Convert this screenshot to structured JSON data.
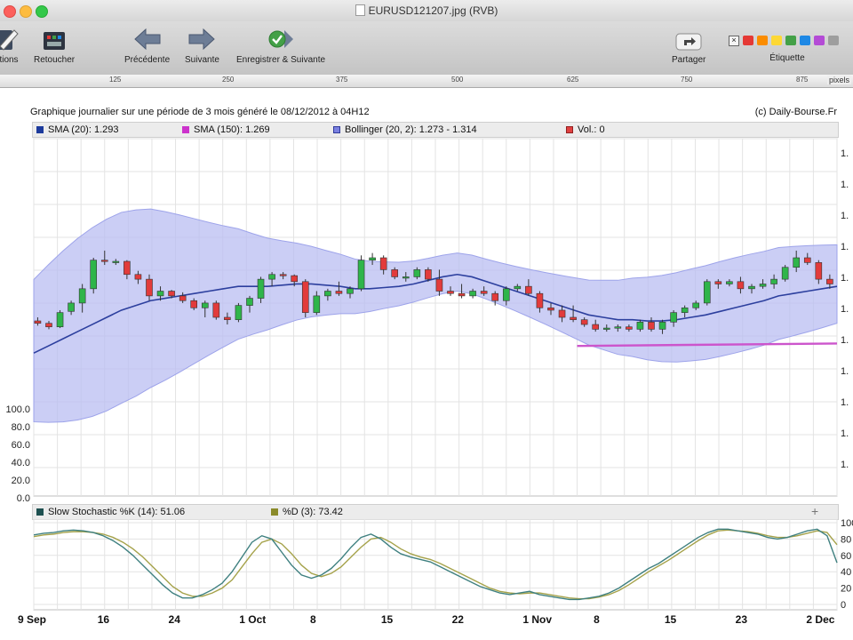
{
  "window": {
    "title": "EURUSD121207.jpg (RVB)"
  },
  "toolbar": {
    "left_items": [
      {
        "label": "tions",
        "icon": "pencil-icon"
      },
      {
        "label": "Retoucher",
        "icon": "toolbox-icon"
      },
      {
        "label": "Précédente",
        "icon": "arrow-left-icon"
      },
      {
        "label": "Suivante",
        "icon": "arrow-right-icon"
      },
      {
        "label": "Enregistrer & Suivante",
        "icon": "check-arrow-icon"
      }
    ],
    "share_label": "Partager",
    "label_label": "Étiquette",
    "label_colors": [
      "#e53935",
      "#fb8c00",
      "#fdd835",
      "#43a047",
      "#1e88e5",
      "#b44bd6",
      "#9e9e9e"
    ]
  },
  "ruler": {
    "ticks": [
      "125",
      "250",
      "375",
      "500",
      "625",
      "750",
      "875"
    ],
    "unit": "pixels"
  },
  "chart_header": {
    "caption": "Graphique journalier sur une période de 3 mois généré le 08/12/2012 à 04H12",
    "copyright": "(c) Daily-Bourse.Fr"
  },
  "legend": [
    {
      "text": "SMA (20): 1.293",
      "color": "#1c3a9c"
    },
    {
      "text": "SMA (150): 1.269",
      "color": "#cc33cc"
    },
    {
      "text": "Bollinger (20, 2): 1.273 - 1.314",
      "color": "#7a80e0"
    },
    {
      "text": "Vol.: 0",
      "color": "#e04040"
    }
  ],
  "stoch_legend": [
    {
      "text": "Slow Stochastic %K (14): 51.06",
      "color": "#1d5050"
    },
    {
      "text": "%D (3): 73.42",
      "color": "#8a8a2a"
    }
  ],
  "chart_data": {
    "type": "candlestick",
    "x_tick_labels": [
      "9 Sep",
      "16",
      "24",
      "1 Oct",
      "8",
      "15",
      "22",
      "1 Nov",
      "8",
      "15",
      "23",
      "2 Dec"
    ],
    "x_tick_index": [
      0,
      9,
      18,
      27,
      36,
      45,
      54,
      63,
      72,
      81,
      90,
      99
    ],
    "y_right_ticks": [
      "1.",
      "1.",
      "1.",
      "1.",
      "1.",
      "1.",
      "1.",
      "1.",
      "1.",
      "1.",
      "1."
    ],
    "y_left_ticks": [
      "100.0",
      "80.0",
      "60.0",
      "40.0",
      "20.0",
      "0.0"
    ],
    "ylim": [
      1.205,
      1.355
    ],
    "candles": [
      [
        1.2785,
        1.28,
        1.2765,
        1.2775
      ],
      [
        1.2775,
        1.2785,
        1.275,
        1.276
      ],
      [
        1.276,
        1.283,
        1.2755,
        1.282
      ],
      [
        1.2825,
        1.287,
        1.281,
        1.286
      ],
      [
        1.286,
        1.294,
        1.282,
        1.292
      ],
      [
        1.292,
        1.305,
        1.29,
        1.304
      ],
      [
        1.304,
        1.308,
        1.302,
        1.3035
      ],
      [
        1.3035,
        1.3045,
        1.302,
        1.3035
      ],
      [
        1.3035,
        1.304,
        1.296,
        1.298
      ],
      [
        1.298,
        1.2995,
        1.294,
        1.296
      ],
      [
        1.296,
        1.298,
        1.287,
        1.289
      ],
      [
        1.289,
        1.293,
        1.287,
        1.291
      ],
      [
        1.291,
        1.2915,
        1.288,
        1.289
      ],
      [
        1.289,
        1.2905,
        1.286,
        1.287
      ],
      [
        1.287,
        1.288,
        1.283,
        1.284
      ],
      [
        1.284,
        1.287,
        1.28,
        1.286
      ],
      [
        1.286,
        1.287,
        1.279,
        1.28
      ],
      [
        1.28,
        1.282,
        1.277,
        1.279
      ],
      [
        1.279,
        1.286,
        1.278,
        1.285
      ],
      [
        1.285,
        1.289,
        1.282,
        1.288
      ],
      [
        1.288,
        1.297,
        1.286,
        1.296
      ],
      [
        1.296,
        1.299,
        1.293,
        1.298
      ],
      [
        1.298,
        1.299,
        1.296,
        1.2975
      ],
      [
        1.2975,
        1.298,
        1.293,
        1.295
      ],
      [
        1.295,
        1.296,
        1.28,
        1.282
      ],
      [
        1.282,
        1.291,
        1.281,
        1.289
      ],
      [
        1.289,
        1.292,
        1.287,
        1.291
      ],
      [
        1.291,
        1.295,
        1.289,
        1.29
      ],
      [
        1.29,
        1.293,
        1.288,
        1.292
      ],
      [
        1.292,
        1.306,
        1.291,
        1.304
      ],
      [
        1.304,
        1.307,
        1.302,
        1.305
      ],
      [
        1.305,
        1.306,
        1.298,
        1.3
      ],
      [
        1.3,
        1.301,
        1.296,
        1.297
      ],
      [
        1.297,
        1.299,
        1.295,
        1.297
      ],
      [
        1.297,
        1.301,
        1.296,
        1.3
      ],
      [
        1.3,
        1.301,
        1.295,
        1.296
      ],
      [
        1.296,
        1.3,
        1.289,
        1.291
      ],
      [
        1.291,
        1.293,
        1.289,
        1.29
      ],
      [
        1.29,
        1.294,
        1.288,
        1.289
      ],
      [
        1.289,
        1.292,
        1.288,
        1.291
      ],
      [
        1.291,
        1.293,
        1.289,
        1.29
      ],
      [
        1.29,
        1.291,
        1.285,
        1.287
      ],
      [
        1.287,
        1.293,
        1.285,
        1.292
      ],
      [
        1.292,
        1.294,
        1.291,
        1.293
      ],
      [
        1.293,
        1.296,
        1.289,
        1.29
      ],
      [
        1.29,
        1.291,
        1.282,
        1.284
      ],
      [
        1.284,
        1.286,
        1.281,
        1.283
      ],
      [
        1.283,
        1.285,
        1.278,
        1.28
      ],
      [
        1.28,
        1.285,
        1.278,
        1.279
      ],
      [
        1.279,
        1.28,
        1.276,
        1.277
      ],
      [
        1.277,
        1.279,
        1.274,
        1.275
      ],
      [
        1.275,
        1.277,
        1.274,
        1.2755
      ],
      [
        1.2755,
        1.277,
        1.274,
        1.276
      ],
      [
        1.276,
        1.277,
        1.274,
        1.275
      ],
      [
        1.275,
        1.279,
        1.274,
        1.278
      ],
      [
        1.278,
        1.28,
        1.274,
        1.275
      ],
      [
        1.275,
        1.279,
        1.273,
        1.278
      ],
      [
        1.278,
        1.283,
        1.276,
        1.282
      ],
      [
        1.282,
        1.285,
        1.28,
        1.284
      ],
      [
        1.284,
        1.287,
        1.283,
        1.286
      ],
      [
        1.286,
        1.296,
        1.285,
        1.295
      ],
      [
        1.295,
        1.296,
        1.292,
        1.294
      ],
      [
        1.294,
        1.296,
        1.293,
        1.295
      ],
      [
        1.295,
        1.297,
        1.29,
        1.292
      ],
      [
        1.292,
        1.294,
        1.29,
        1.293
      ],
      [
        1.293,
        1.296,
        1.292,
        1.294
      ],
      [
        1.294,
        1.298,
        1.292,
        1.296
      ],
      [
        1.296,
        1.302,
        1.295,
        1.301
      ],
      [
        1.301,
        1.308,
        1.299,
        1.305
      ],
      [
        1.305,
        1.307,
        1.302,
        1.303
      ],
      [
        1.303,
        1.304,
        1.294,
        1.296
      ],
      [
        1.296,
        1.298,
        1.292,
        1.294
      ]
    ],
    "series": [
      {
        "name": "SMA (20)",
        "color": "#2c3f9e",
        "values": [
          1.265,
          1.268,
          1.271,
          1.274,
          1.277,
          1.28,
          1.283,
          1.285,
          1.287,
          1.288,
          1.289,
          1.29,
          1.291,
          1.292,
          1.293,
          1.293,
          1.293,
          1.2935,
          1.294,
          1.294,
          1.2935,
          1.293,
          1.292,
          1.292,
          1.2925,
          1.293,
          1.294,
          1.2955,
          1.297,
          1.298,
          1.297,
          1.295,
          1.293,
          1.291,
          1.289,
          1.287,
          1.285,
          1.283,
          1.281,
          1.28,
          1.279,
          1.279,
          1.2785,
          1.2785,
          1.279,
          1.28,
          1.281,
          1.2825,
          1.284,
          1.2855,
          1.287,
          1.289,
          1.29,
          1.291,
          1.292,
          1.293
        ]
      },
      {
        "name": "SMA (150)",
        "color": "#cc55cc",
        "values": [
          1.268,
          1.269
        ]
      },
      {
        "name": "Bollinger (20, 2)",
        "color": "#7a80e0",
        "values": []
      }
    ]
  },
  "stoch_data": {
    "k": [
      85,
      87,
      88,
      90,
      91,
      90,
      88,
      84,
      78,
      70,
      60,
      48,
      36,
      24,
      14,
      8,
      8,
      12,
      18,
      26,
      40,
      58,
      76,
      84,
      80,
      64,
      48,
      36,
      32,
      36,
      44,
      56,
      70,
      82,
      86,
      80,
      70,
      62,
      58,
      55,
      52,
      46,
      40,
      34,
      28,
      22,
      18,
      14,
      12,
      14,
      16,
      12,
      10,
      8,
      6,
      6,
      8,
      10,
      14,
      20,
      28,
      36,
      44,
      50,
      58,
      66,
      74,
      82,
      88,
      92,
      92,
      90,
      88,
      86,
      82,
      80,
      82,
      86,
      90,
      92,
      84,
      51
    ],
    "d": [
      83,
      85,
      86,
      88,
      89,
      89,
      88,
      86,
      82,
      76,
      68,
      58,
      46,
      34,
      22,
      14,
      10,
      10,
      14,
      20,
      30,
      46,
      62,
      76,
      80,
      74,
      62,
      48,
      38,
      34,
      38,
      46,
      58,
      70,
      80,
      82,
      76,
      68,
      62,
      58,
      55,
      50,
      44,
      38,
      32,
      26,
      20,
      16,
      14,
      13,
      14,
      14,
      12,
      10,
      8,
      7,
      7,
      9,
      12,
      17,
      24,
      32,
      40,
      47,
      54,
      62,
      70,
      78,
      85,
      90,
      91,
      90,
      89,
      87,
      84,
      82,
      82,
      84,
      87,
      90,
      88,
      73
    ]
  }
}
